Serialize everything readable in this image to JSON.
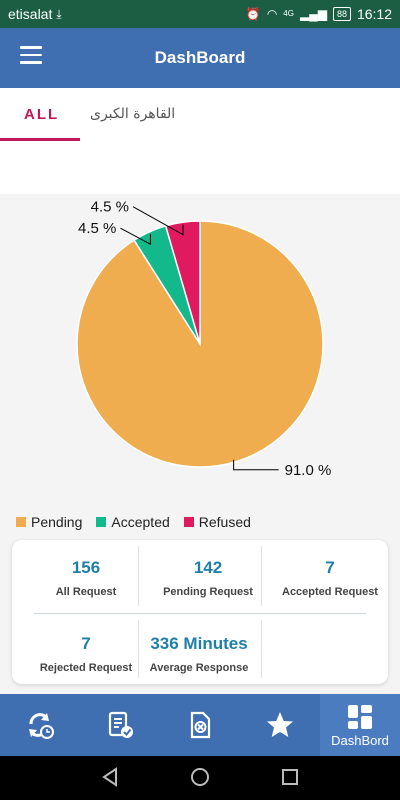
{
  "status_bar": {
    "carrier": "etisalat",
    "battery": "88",
    "time": "16:12",
    "network": "4G"
  },
  "app_bar": {
    "title": "DashBoard"
  },
  "tabs": [
    {
      "label": "ALL",
      "active": true
    },
    {
      "label": "القاهرة الكبرى",
      "active": false
    }
  ],
  "chart_data": {
    "type": "pie",
    "slices": [
      {
        "label": "Pending",
        "value": 91.0,
        "color": "#efad50",
        "display": "91.0 %"
      },
      {
        "label": "Accepted",
        "value": 4.5,
        "color": "#13b98a",
        "display": "4.5 %"
      },
      {
        "label": "Refused",
        "value": 4.5,
        "color": "#e01a5e",
        "display": "4.5 %"
      }
    ],
    "legend_placement": "bottom-left"
  },
  "legend": [
    {
      "label": "Pending",
      "color": "#efad50"
    },
    {
      "label": "Accepted",
      "color": "#13b98a"
    },
    {
      "label": "Refused",
      "color": "#e01a5e"
    }
  ],
  "stats": [
    {
      "value": "156",
      "label": "All Request"
    },
    {
      "value": "142",
      "label": "Pending Request"
    },
    {
      "value": "7",
      "label": "Accepted Request"
    },
    {
      "value": "7",
      "label": "Rejected Request"
    },
    {
      "value": "336 Minutes",
      "label": "Average Response"
    }
  ],
  "bottom_nav": [
    {
      "icon": "refresh-clock-icon",
      "label": ""
    },
    {
      "icon": "document-check-icon",
      "label": ""
    },
    {
      "icon": "document-cancel-icon",
      "label": ""
    },
    {
      "icon": "star-icon",
      "label": ""
    },
    {
      "icon": "dashboard-grid-icon",
      "label": "DashBord",
      "active": true
    }
  ],
  "colors": {
    "app_bar": "#3f6fb0",
    "accent": "#c2185b",
    "stat_value": "#1f7fa8",
    "status_bar": "#1b5e44"
  }
}
